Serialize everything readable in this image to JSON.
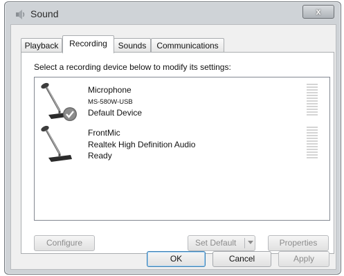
{
  "window": {
    "title": "Sound",
    "close_label": "x"
  },
  "tabs": [
    {
      "label": "Playback"
    },
    {
      "label": "Recording"
    },
    {
      "label": "Sounds"
    },
    {
      "label": "Communications"
    }
  ],
  "active_tab": "Recording",
  "instruction": "Select a recording device below to modify its settings:",
  "devices": [
    {
      "name": "Microphone",
      "description": "MS-580W-USB",
      "status": "Default Device",
      "is_default": true,
      "level": 0
    },
    {
      "name": "FrontMic",
      "description": "Realtek High Definition Audio",
      "status": "Ready",
      "is_default": false,
      "level": 0
    }
  ],
  "buttons": {
    "configure": "Configure",
    "set_default": "Set Default",
    "properties": "Properties",
    "ok": "OK",
    "cancel": "Cancel",
    "apply": "Apply"
  },
  "colors": {
    "default_check": "#3f8a3a"
  }
}
